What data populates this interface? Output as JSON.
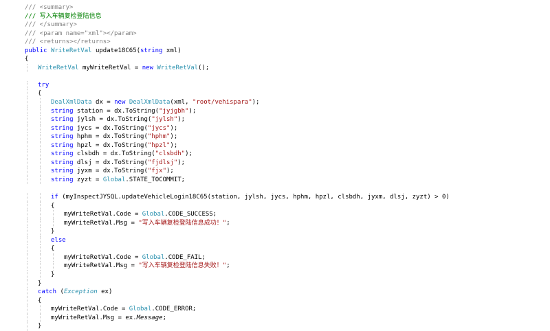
{
  "editor": {
    "language": "C#",
    "colors": {
      "keyword": "#0000ff",
      "type": "#2b91af",
      "string": "#a31515",
      "comment": "#008000",
      "xml_doc": "#808080",
      "text": "#000000",
      "background": "#ffffff"
    },
    "lines": [
      {
        "indent": 0,
        "tokens": [
          {
            "c": "xml",
            "t": "/// <summary>"
          }
        ]
      },
      {
        "indent": 0,
        "tokens": [
          {
            "c": "cmt",
            "t": "/// 写入车辆复检登陆信息"
          }
        ]
      },
      {
        "indent": 0,
        "tokens": [
          {
            "c": "xml",
            "t": "/// </summary>"
          }
        ]
      },
      {
        "indent": 0,
        "tokens": [
          {
            "c": "xml",
            "t": "/// <param name=\"xml\"></param>"
          }
        ]
      },
      {
        "indent": 0,
        "tokens": [
          {
            "c": "xml",
            "t": "/// <returns></returns>"
          }
        ]
      },
      {
        "indent": 0,
        "tokens": [
          {
            "c": "kw",
            "t": "public "
          },
          {
            "c": "type",
            "t": "WriteRetVal"
          },
          {
            "c": "plain",
            "t": " update18C65("
          },
          {
            "c": "kw",
            "t": "string"
          },
          {
            "c": "plain",
            "t": " xml)"
          }
        ]
      },
      {
        "indent": 0,
        "tokens": [
          {
            "c": "plain",
            "t": "{"
          }
        ]
      },
      {
        "indent": 1,
        "tokens": [
          {
            "c": "type",
            "t": "WriteRetVal"
          },
          {
            "c": "plain",
            "t": " myWriteRetVal = "
          },
          {
            "c": "kw",
            "t": "new "
          },
          {
            "c": "type",
            "t": "WriteRetVal"
          },
          {
            "c": "plain",
            "t": "();"
          }
        ]
      },
      {
        "indent": 0,
        "tokens": []
      },
      {
        "indent": 1,
        "tokens": [
          {
            "c": "kw",
            "t": "try"
          }
        ]
      },
      {
        "indent": 1,
        "tokens": [
          {
            "c": "plain",
            "t": "{"
          }
        ]
      },
      {
        "indent": 2,
        "tokens": [
          {
            "c": "type",
            "t": "DealXmlData"
          },
          {
            "c": "plain",
            "t": " dx = "
          },
          {
            "c": "kw",
            "t": "new "
          },
          {
            "c": "type",
            "t": "DealXmlData"
          },
          {
            "c": "plain",
            "t": "(xml, "
          },
          {
            "c": "str",
            "t": "\"root/vehispara\""
          },
          {
            "c": "plain",
            "t": ");"
          }
        ]
      },
      {
        "indent": 2,
        "tokens": [
          {
            "c": "kw",
            "t": "string"
          },
          {
            "c": "plain",
            "t": " station = dx.ToString("
          },
          {
            "c": "str",
            "t": "\"jyjgbh\""
          },
          {
            "c": "plain",
            "t": ");"
          }
        ]
      },
      {
        "indent": 2,
        "tokens": [
          {
            "c": "kw",
            "t": "string"
          },
          {
            "c": "plain",
            "t": " jylsh = dx.ToString("
          },
          {
            "c": "str",
            "t": "\"jylsh\""
          },
          {
            "c": "plain",
            "t": ");"
          }
        ]
      },
      {
        "indent": 2,
        "tokens": [
          {
            "c": "kw",
            "t": "string"
          },
          {
            "c": "plain",
            "t": " jycs = dx.ToString("
          },
          {
            "c": "str",
            "t": "\"jycs\""
          },
          {
            "c": "plain",
            "t": ");"
          }
        ]
      },
      {
        "indent": 2,
        "tokens": [
          {
            "c": "kw",
            "t": "string"
          },
          {
            "c": "plain",
            "t": " hphm = dx.ToString("
          },
          {
            "c": "str",
            "t": "\"hphm\""
          },
          {
            "c": "plain",
            "t": ");"
          }
        ]
      },
      {
        "indent": 2,
        "tokens": [
          {
            "c": "kw",
            "t": "string"
          },
          {
            "c": "plain",
            "t": " hpzl = dx.ToString("
          },
          {
            "c": "str",
            "t": "\"hpzl\""
          },
          {
            "c": "plain",
            "t": ");"
          }
        ]
      },
      {
        "indent": 2,
        "tokens": [
          {
            "c": "kw",
            "t": "string"
          },
          {
            "c": "plain",
            "t": " clsbdh = dx.ToString("
          },
          {
            "c": "str",
            "t": "\"clsbdh\""
          },
          {
            "c": "plain",
            "t": ");"
          }
        ]
      },
      {
        "indent": 2,
        "tokens": [
          {
            "c": "kw",
            "t": "string"
          },
          {
            "c": "plain",
            "t": " dlsj = dx.ToString("
          },
          {
            "c": "str",
            "t": "\"fjdlsj\""
          },
          {
            "c": "plain",
            "t": ");"
          }
        ]
      },
      {
        "indent": 2,
        "tokens": [
          {
            "c": "kw",
            "t": "string"
          },
          {
            "c": "plain",
            "t": " jyxm = dx.ToString("
          },
          {
            "c": "str",
            "t": "\"fjx\""
          },
          {
            "c": "plain",
            "t": ");"
          }
        ]
      },
      {
        "indent": 2,
        "tokens": [
          {
            "c": "kw",
            "t": "string"
          },
          {
            "c": "plain",
            "t": " zyzt = "
          },
          {
            "c": "type",
            "t": "Global"
          },
          {
            "c": "plain",
            "t": ".STATE_TOCOMMIT;"
          }
        ]
      },
      {
        "indent": 0,
        "tokens": []
      },
      {
        "indent": 2,
        "tokens": [
          {
            "c": "kw",
            "t": "if"
          },
          {
            "c": "plain",
            "t": " (myInspectJYSQL.updateVehicleLogin18C65(station, jylsh, jycs, hphm, hpzl, clsbdh, jyxm, dlsj, zyzt) > 0)"
          }
        ]
      },
      {
        "indent": 2,
        "tokens": [
          {
            "c": "plain",
            "t": "{"
          }
        ]
      },
      {
        "indent": 3,
        "tokens": [
          {
            "c": "plain",
            "t": "myWriteRetVal.Code = "
          },
          {
            "c": "type",
            "t": "Global"
          },
          {
            "c": "plain",
            "t": ".CODE_SUCCESS;"
          }
        ]
      },
      {
        "indent": 3,
        "tokens": [
          {
            "c": "plain",
            "t": "myWriteRetVal.Msg = "
          },
          {
            "c": "str",
            "t": "\"写入车辆复检登陆信息成功！\""
          },
          {
            "c": "plain",
            "t": ";"
          }
        ]
      },
      {
        "indent": 2,
        "tokens": [
          {
            "c": "plain",
            "t": "}"
          }
        ]
      },
      {
        "indent": 2,
        "tokens": [
          {
            "c": "kw",
            "t": "else"
          }
        ]
      },
      {
        "indent": 2,
        "tokens": [
          {
            "c": "plain",
            "t": "{"
          }
        ]
      },
      {
        "indent": 3,
        "tokens": [
          {
            "c": "plain",
            "t": "myWriteRetVal.Code = "
          },
          {
            "c": "type",
            "t": "Global"
          },
          {
            "c": "plain",
            "t": ".CODE_FAIL;"
          }
        ]
      },
      {
        "indent": 3,
        "tokens": [
          {
            "c": "plain",
            "t": "myWriteRetVal.Msg = "
          },
          {
            "c": "str",
            "t": "\"写入车辆复检登陆信息失败！\""
          },
          {
            "c": "plain",
            "t": ";"
          }
        ]
      },
      {
        "indent": 2,
        "tokens": [
          {
            "c": "plain",
            "t": "}"
          }
        ]
      },
      {
        "indent": 1,
        "tokens": [
          {
            "c": "plain",
            "t": "}"
          }
        ]
      },
      {
        "indent": 1,
        "tokens": [
          {
            "c": "kw",
            "t": "catch"
          },
          {
            "c": "plain",
            "t": " ("
          },
          {
            "c": "type it",
            "t": "Exception"
          },
          {
            "c": "plain",
            "t": " ex)"
          }
        ]
      },
      {
        "indent": 1,
        "tokens": [
          {
            "c": "plain",
            "t": "{"
          }
        ]
      },
      {
        "indent": 2,
        "tokens": [
          {
            "c": "plain",
            "t": "myWriteRetVal.Code = "
          },
          {
            "c": "type",
            "t": "Global"
          },
          {
            "c": "plain",
            "t": ".CODE_ERROR;"
          }
        ]
      },
      {
        "indent": 2,
        "tokens": [
          {
            "c": "plain",
            "t": "myWriteRetVal.Msg = ex."
          },
          {
            "c": "plain it",
            "t": "Message"
          },
          {
            "c": "plain",
            "t": ";"
          }
        ]
      },
      {
        "indent": 1,
        "tokens": [
          {
            "c": "plain",
            "t": "}"
          }
        ]
      }
    ]
  }
}
